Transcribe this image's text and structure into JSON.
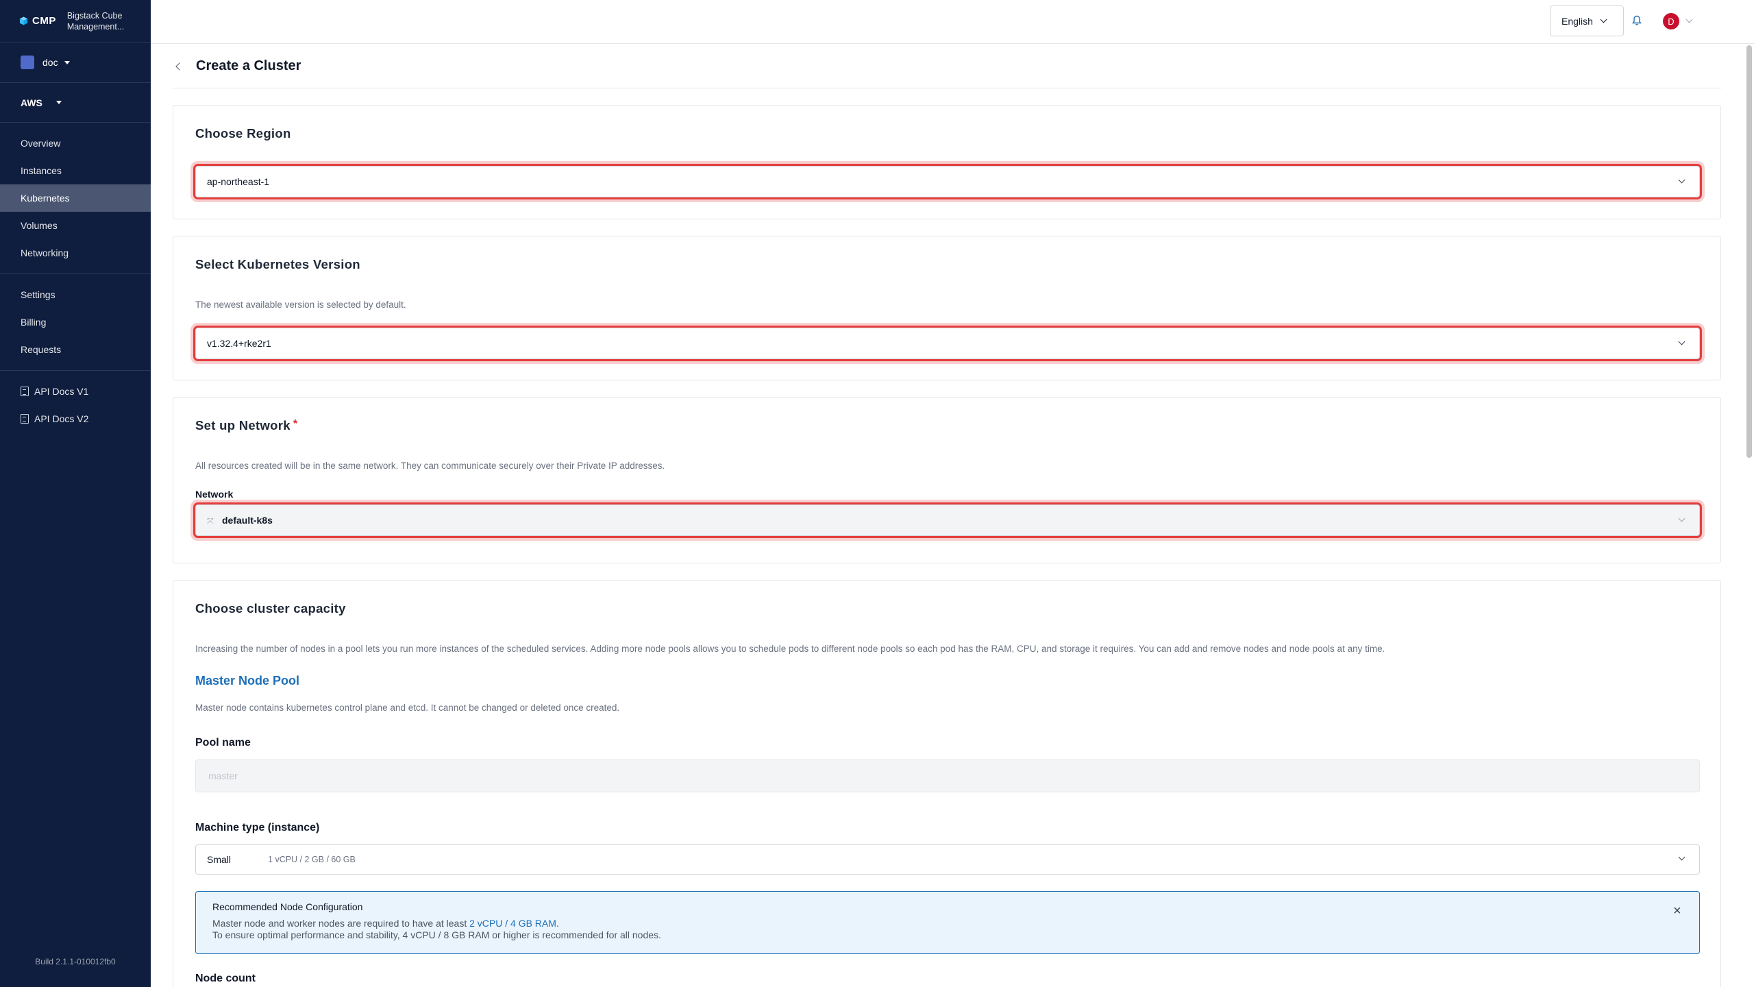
{
  "brand": {
    "logo_text": "CMP",
    "subtitle_line1": "Bigstack Cube",
    "subtitle_line2": "Management..."
  },
  "project": {
    "name": "doc"
  },
  "provider": {
    "name": "AWS"
  },
  "sidebar": {
    "nav": [
      {
        "label": "Overview"
      },
      {
        "label": "Instances"
      },
      {
        "label": "Kubernetes",
        "active": true
      },
      {
        "label": "Volumes"
      },
      {
        "label": "Networking"
      }
    ],
    "settings": [
      {
        "label": "Settings"
      },
      {
        "label": "Billing"
      },
      {
        "label": "Requests"
      }
    ],
    "docs": [
      {
        "label": "API Docs V1",
        "icon": "document-icon"
      },
      {
        "label": "API Docs V2",
        "icon": "document-icon"
      }
    ],
    "build": "Build 2.1.1-010012fb0"
  },
  "topbar": {
    "language": "English",
    "avatar_initial": "D",
    "avatar_color": "#c8102e"
  },
  "page": {
    "title": "Create a Cluster"
  },
  "region": {
    "title": "Choose Region",
    "value": "ap-northeast-1"
  },
  "k8s": {
    "title": "Select Kubernetes Version",
    "helper": "The newest available version is selected by default.",
    "value": "v1.32.4+rke2r1"
  },
  "network": {
    "title": "Set up Network",
    "required": "*",
    "helper": "All resources created will be in the same network. They can communicate securely over their Private IP addresses.",
    "label": "Network",
    "value": "default-k8s"
  },
  "capacity": {
    "title": "Choose cluster capacity",
    "helper": "Increasing the number of nodes in a pool lets you run more instances of the scheduled services. Adding more node pools allows you to schedule pods to different node pools so each pod has the RAM, CPU, and storage it requires. You can add and remove nodes and node pools at any time.",
    "master_pool_title": "Master Node Pool",
    "master_pool_helper": "Master node contains kubernetes control plane and etcd. It cannot be changed or deleted once created.",
    "pool_name_label": "Pool name",
    "pool_name_placeholder": "master",
    "machine_label": "Machine type (instance)",
    "machine_value": "Small",
    "machine_spec": "1 vCPU / 2 GB / 60 GB",
    "notice": {
      "title": "Recommended Node Configuration",
      "line1_prefix": "Master node and worker nodes are required to have at least ",
      "line1_highlight": "2 vCPU / 4 GB RAM",
      "line1_suffix": ".",
      "line2": "To ensure optimal performance and stability, 4 vCPU / 8 GB RAM or higher is recommended for all nodes."
    },
    "node_count_label": "Node count"
  },
  "colors": {
    "sidebar_bg": "#0f1d3e",
    "accent_blue": "#1d6fb8",
    "error_red": "#e53e3e"
  }
}
